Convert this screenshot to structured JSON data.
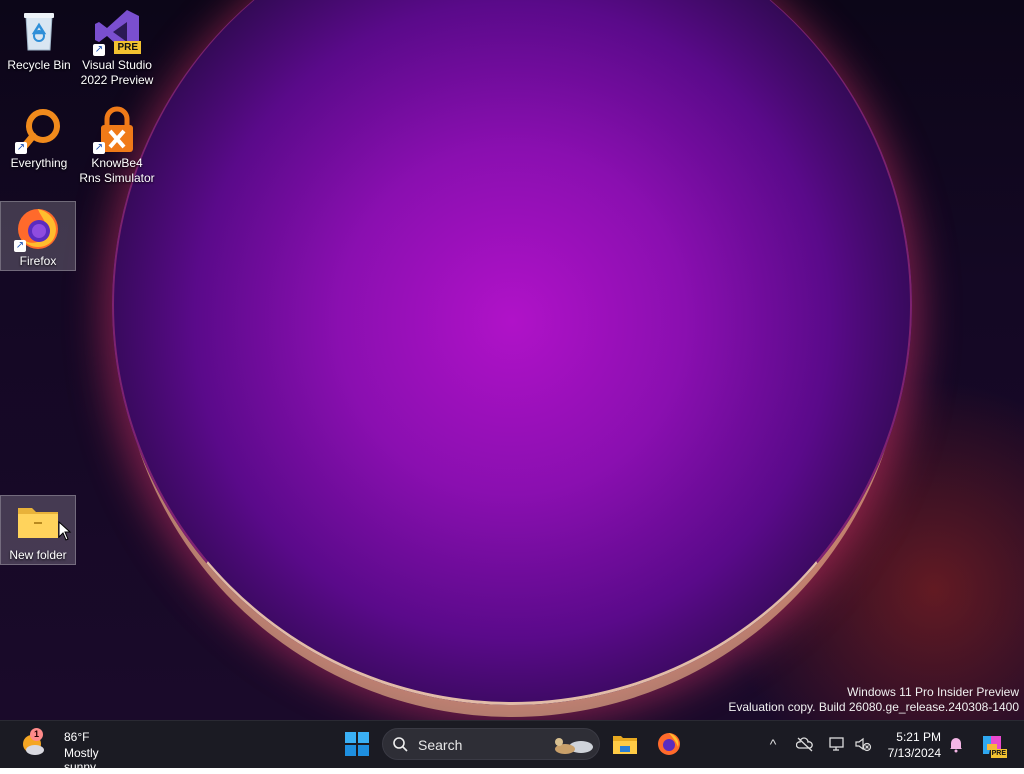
{
  "desktop": {
    "icons": [
      {
        "label": "Recycle Bin",
        "icon": "recycle-bin-icon"
      },
      {
        "label": "Visual Studio 2022 Preview",
        "badge": "PRE",
        "icon": "visual-studio-icon"
      },
      {
        "label": "Everything",
        "icon": "everything-search-icon"
      },
      {
        "label": "KnowBe4 Rns Simulator",
        "icon": "knowbe4-lock-icon"
      },
      {
        "label": "Firefox",
        "icon": "firefox-icon"
      },
      {
        "label": "New folder",
        "icon": "folder-icon"
      }
    ],
    "shortcut_arrow": "↗"
  },
  "watermark": {
    "line1": "Windows 11 Pro Insider Preview",
    "line2": "Evaluation copy. Build 26080.ge_release.240308-1400"
  },
  "taskbar": {
    "weather": {
      "temp": "86°F",
      "condition": "Mostly sunny",
      "alert": "1"
    },
    "search_label": "Search",
    "tray": {
      "chevron": "^"
    },
    "clock": {
      "time": "5:21 PM",
      "date": "7/13/2024"
    },
    "copilot_badge": "PRE"
  }
}
